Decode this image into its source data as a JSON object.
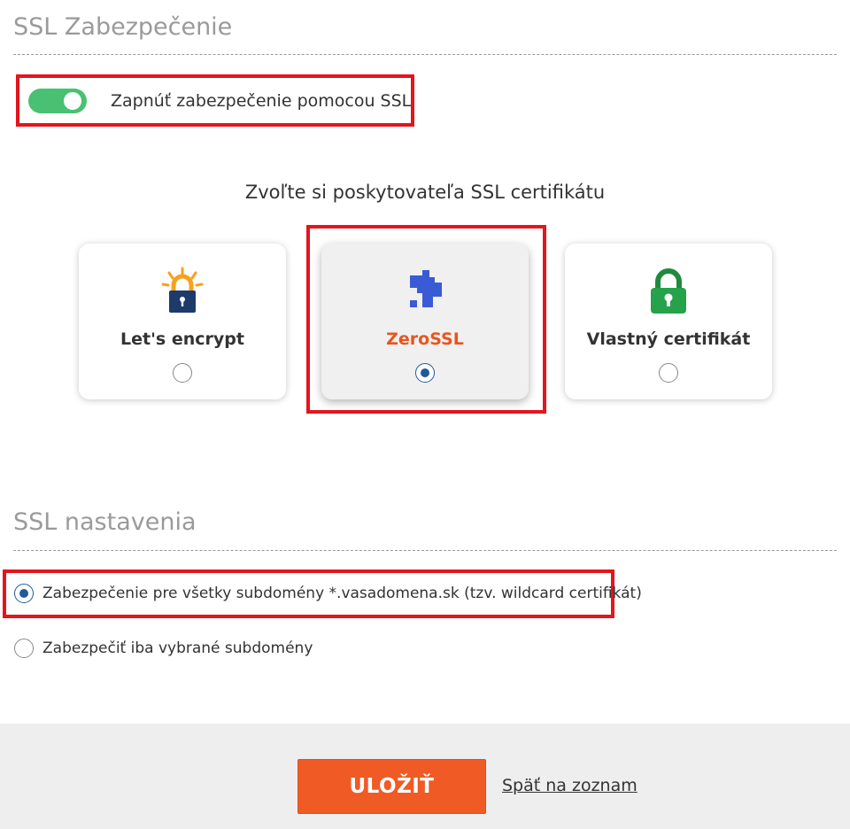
{
  "ssl_section": {
    "title": "SSL Zabezpečenie",
    "toggle_label": "Zapnúť zabezpečenie pomocou SSL",
    "toggle_on": true
  },
  "provider": {
    "title": "Zvoľte si poskytovateľa SSL certifikátu",
    "cards": [
      {
        "label": "Let's encrypt",
        "icon": "lets-encrypt-lock-icon",
        "selected": false
      },
      {
        "label": "ZeroSSL",
        "icon": "zerossl-puzzle-icon",
        "selected": true
      },
      {
        "label": "Vlastný certifikát",
        "icon": "padlock-icon",
        "selected": false
      }
    ]
  },
  "settings_section": {
    "title": "SSL nastavenia",
    "options": [
      {
        "label": "Zabezpečenie pre všetky subdomény *.vasadomena.sk (tzv. wildcard certifikát)",
        "selected": true
      },
      {
        "label": "Zabezpečiť iba vybrané subdomény",
        "selected": false
      }
    ]
  },
  "footer": {
    "save_label": "ULOŽIŤ",
    "back_label": "Späť na zoznam"
  },
  "colors": {
    "accent": "#f05a24",
    "toggle": "#48c172",
    "highlight": "#e3151d",
    "radio": "#1f5a9c",
    "zerossl_blue": "#3a5bd6",
    "padlock_green": "#25a24a",
    "lets_encrypt_navy": "#1d3a6b",
    "lets_encrypt_orange": "#f7a11b"
  }
}
